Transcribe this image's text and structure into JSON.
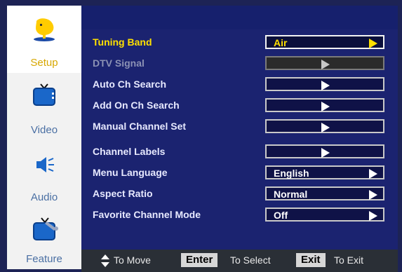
{
  "sidebar": {
    "items": [
      {
        "label": "Setup",
        "icon": "setup-icon",
        "active": true
      },
      {
        "label": "Video",
        "icon": "tv-icon",
        "active": false
      },
      {
        "label": "Audio",
        "icon": "speaker-icon",
        "active": false
      },
      {
        "label": "Feature",
        "icon": "feature-tv-wrench-icon",
        "active": false
      }
    ]
  },
  "menu": {
    "rows": [
      {
        "name": "Tuning Band",
        "value": "Air",
        "state": "selected"
      },
      {
        "name": "DTV Signal",
        "value": "",
        "state": "disabled"
      },
      {
        "name": "Auto Ch Search",
        "value": "",
        "state": "normal"
      },
      {
        "name": "Add On Ch Search",
        "value": "",
        "state": "normal"
      },
      {
        "name": "Manual Channel Set",
        "value": "",
        "state": "normal"
      },
      {
        "name": "Channel Labels",
        "value": "",
        "state": "normal"
      },
      {
        "name": "Menu Language",
        "value": "English",
        "state": "normal"
      },
      {
        "name": "Aspect Ratio",
        "value": "Normal",
        "state": "normal"
      },
      {
        "name": "Favorite Channel Mode",
        "value": "Off",
        "state": "normal"
      }
    ]
  },
  "footer": {
    "move_text": "To Move",
    "enter_key": "Enter",
    "select_text": "To Select",
    "exit_key": "Exit",
    "exit_text": "To Exit"
  },
  "colors": {
    "panel": "#1b2370",
    "highlight": "#ffe000",
    "sidebar_active_label": "#d7a700",
    "sidebar_label": "#4a6fa3"
  }
}
